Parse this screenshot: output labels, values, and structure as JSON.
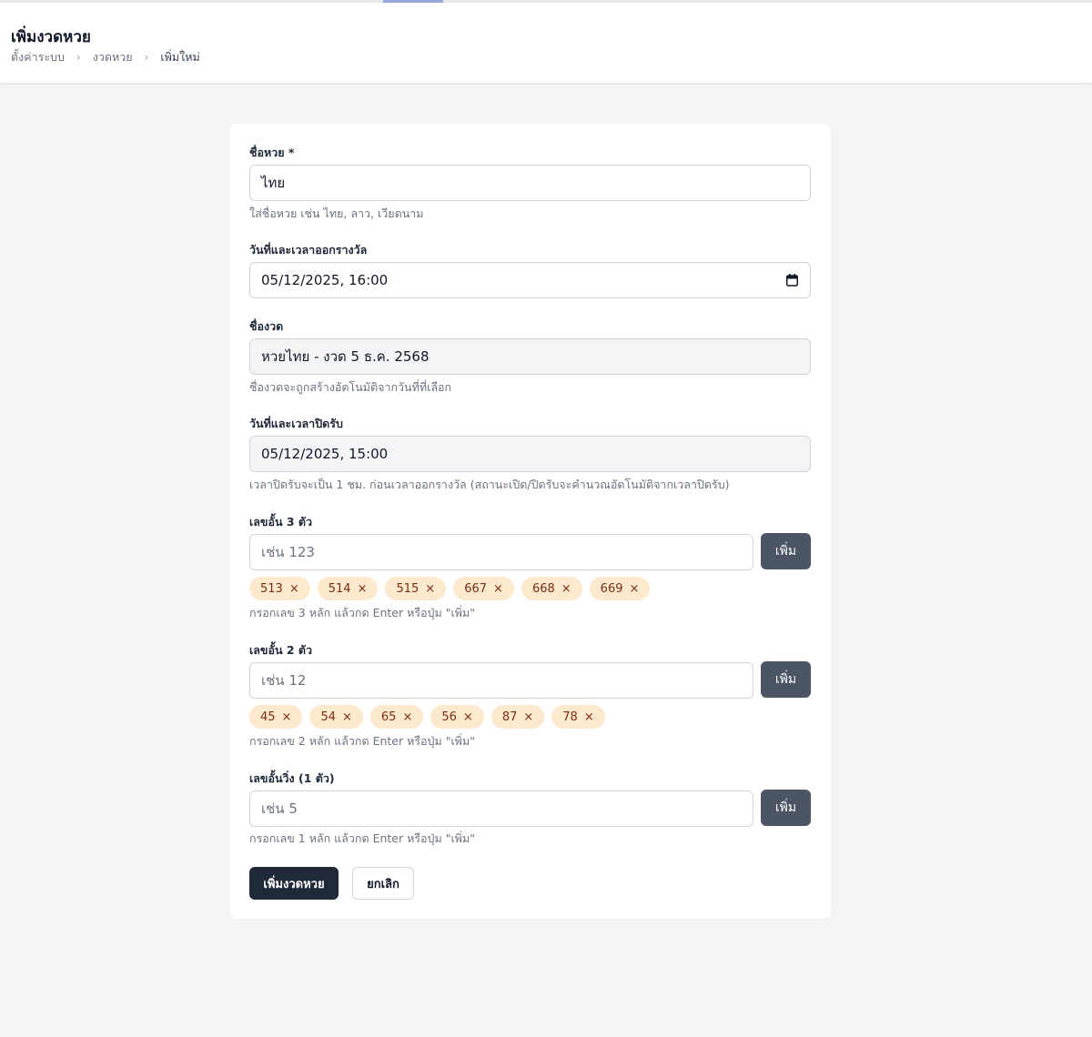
{
  "header": {
    "title": "เพิ่มงวดหวย",
    "breadcrumb": [
      "ตั้งค่าระบบ",
      "งวดหวย",
      "เพิ่มใหม่"
    ]
  },
  "form": {
    "lottery_name": {
      "label": "ชื่อหวย *",
      "value": "ไทย",
      "help": "ใส่ชื่อหวย เช่น ไทย, ลาว, เวียดนาม"
    },
    "draw_datetime": {
      "label": "วันที่และเวลาออกรางวัล",
      "value": "05/12/2025, 16:00",
      "icon": "calendar-icon"
    },
    "round_name": {
      "label": "ชื่องวด",
      "value": "หวยไทย - งวด 5 ธ.ค. 2568",
      "help": "ชื่องวดจะถูกสร้างอัตโนมัติจากวันที่ที่เลือก"
    },
    "close_datetime": {
      "label": "วันที่และเวลาปิดรับ",
      "value": "05/12/2025, 15:00",
      "help": "เวลาปิดรับจะเป็น 1 ชม. ก่อนเวลาออกรางวัล (สถานะเปิด/ปิดรับจะคำนวณอัตโนมัติจากเวลาปิดรับ)"
    },
    "block3": {
      "label": "เลขอั้น 3 ตัว",
      "placeholder": "เช่น 123",
      "add_label": "เพิ่ม",
      "tags": [
        "513",
        "514",
        "515",
        "667",
        "668",
        "669"
      ],
      "help": "กรอกเลข 3 หลัก แล้วกด Enter หรือปุ่ม \"เพิ่ม\""
    },
    "block2": {
      "label": "เลขอั้น 2 ตัว",
      "placeholder": "เช่น 12",
      "add_label": "เพิ่ม",
      "tags": [
        "45",
        "54",
        "65",
        "56",
        "87",
        "78"
      ],
      "help": "กรอกเลข 2 หลัก แล้วกด Enter หรือปุ่ม \"เพิ่ม\""
    },
    "block1": {
      "label": "เลขอั้นวิ่ง (1 ตัว)",
      "placeholder": "เช่น 5",
      "add_label": "เพิ่ม",
      "help": "กรอกเลข 1 หลัก แล้วกด Enter หรือปุ่ม \"เพิ่ม\""
    },
    "submit_label": "เพิ่มงวดหวย",
    "cancel_label": "ยกเลิก",
    "tag_remove_glyph": "×"
  },
  "colors": {
    "tag_bg": "#fde9cd",
    "tag_text": "#7c2d12",
    "primary_button": "#1f2937",
    "add_button": "#4b5563"
  }
}
